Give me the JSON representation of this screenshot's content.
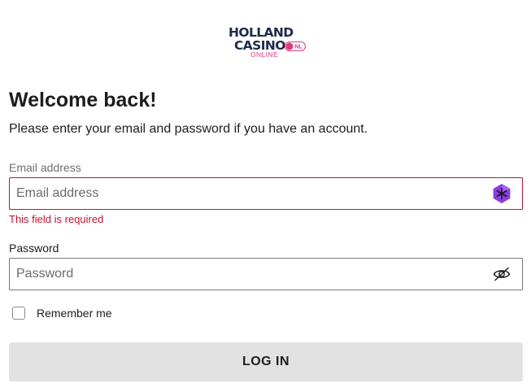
{
  "logo": {
    "line1": "HOLLAND",
    "line2": "CASINO",
    "sub": "ONLINE",
    "badge": "NL"
  },
  "title": "Welcome back!",
  "subtitle": "Please enter your email and password if you have an account.",
  "email": {
    "label": "Email address",
    "placeholder": "Email address",
    "value": "",
    "error": "This field is required"
  },
  "password": {
    "label": "Password",
    "placeholder": "Password",
    "value": ""
  },
  "remember": {
    "label": "Remember me",
    "checked": false
  },
  "login_button": "LOG IN",
  "colors": {
    "error": "#c8102e",
    "brand_navy": "#1e2a4a",
    "brand_pink": "#e0397a",
    "button_bg": "#e2e2e2",
    "extension_purple": "#8b3fd9"
  },
  "icons": {
    "email_field_icon": "password-manager-extension-icon",
    "password_field_icon": "eye-slash-icon"
  }
}
